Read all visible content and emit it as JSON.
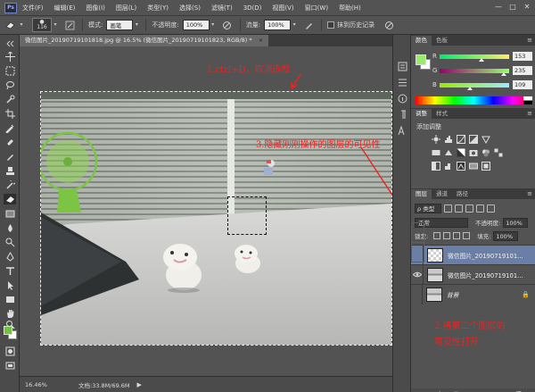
{
  "app": {
    "logo": "Ps",
    "menu": [
      "文件(F)",
      "编辑(E)",
      "图像(I)",
      "图层(L)",
      "类型(Y)",
      "选择(S)",
      "滤镜(T)",
      "3D(D)",
      "视图(V)",
      "窗口(W)",
      "帮助(H)"
    ],
    "window_controls": [
      "—",
      "□",
      "✕"
    ]
  },
  "options": {
    "brush_size": "116",
    "mode_label": "模式:",
    "mode_value": "画笔",
    "opacity_label": "不透明度:",
    "opacity_value": "100%",
    "flow_label": "流量:",
    "flow_value": "100%",
    "history_label": "抹到历史记录"
  },
  "document": {
    "tab_title": "微信图片_20190719101818.jpg @ 16.5% (微信图片_20190719101823, RGB/8) *",
    "close": "×"
  },
  "annotations": {
    "step1": "1.ctrl+D，取消选框",
    "step3": "3.隐藏刚刚操作的图层的可见性",
    "step2_line1": "2.将第二个图层的",
    "step2_line2": "可见性打开"
  },
  "status": {
    "zoom": "16.46%",
    "doc_info": "文档:33.8M/69.6M",
    "arrow": "▶"
  },
  "color_panel": {
    "tabs": [
      "颜色",
      "色板"
    ],
    "fg_color": "#99eb6d",
    "channels": [
      {
        "label": "R",
        "value": "153",
        "level": 0.6
      },
      {
        "label": "G",
        "value": "235",
        "level": 0.92
      },
      {
        "label": "B",
        "value": "109",
        "level": 0.43
      }
    ]
  },
  "adjust_panel": {
    "tabs": [
      "调整",
      "样式"
    ],
    "title": "添加调整"
  },
  "layers_panel": {
    "tabs": [
      "图层",
      "通道",
      "路径"
    ],
    "kind": "ρ 类型",
    "blend_mode": "正常",
    "opacity_label": "不透明度:",
    "opacity_value": "100%",
    "lock_label": "锁定:",
    "fill_label": "填充:",
    "fill_value": "100%",
    "layers": [
      {
        "name": "微信图片_20190719101...",
        "visible": false,
        "selected": true
      },
      {
        "name": "微信图片_20190719101...",
        "visible": true,
        "selected": false
      },
      {
        "name": "背景",
        "visible": false,
        "selected": false,
        "locked": true
      }
    ],
    "footer_icons": [
      "link-icon",
      "fx-icon",
      "mask-icon",
      "adjustment-icon",
      "folder-icon",
      "new-layer-icon",
      "trash-icon"
    ],
    "footer_glyphs": [
      "∞",
      "fx",
      "◘",
      "◑",
      "▬",
      "▣",
      "🗑"
    ]
  },
  "colors": {
    "accent_red": "#ee2222",
    "selected_layer": "#6b7ea5",
    "foreground_tool": "#72c23f"
  }
}
